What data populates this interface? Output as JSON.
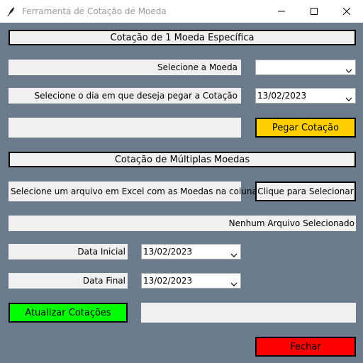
{
  "window": {
    "title": "Ferramenta de Cotação de Moeda",
    "icons": {
      "app": "feather-icon",
      "minimize": "minimize-icon",
      "maximize": "maximize-icon",
      "close": "close-icon"
    }
  },
  "single": {
    "heading": "Cotação de 1 Moeda Específica",
    "currency_label": "Selecione a Moeda",
    "currency_value": "",
    "date_label": "Selecione o dia em que deseja pegar a Cotação",
    "date_value": "13/02/2023",
    "result_text": "",
    "get_button": "Pegar Cotação"
  },
  "multiple": {
    "heading": "Cotação de Múltiplas Moedas",
    "file_label": "Selecione um arquivo em Excel com as Moedas na coluna A:",
    "select_button": "Clique para Selecionar",
    "file_status": "Nenhum Arquivo Selecionado",
    "start_label": "Data Inicial",
    "start_value": "13/02/2023",
    "end_label": "Data Final",
    "end_value": "13/02/2023",
    "update_button": "Atualizar Cotações",
    "update_status": ""
  },
  "close_button": "Fechar",
  "colors": {
    "background": "#6b7b8c",
    "get_button": "#ffd000",
    "update_button": "#00ff00",
    "close_button": "#ff0000"
  }
}
